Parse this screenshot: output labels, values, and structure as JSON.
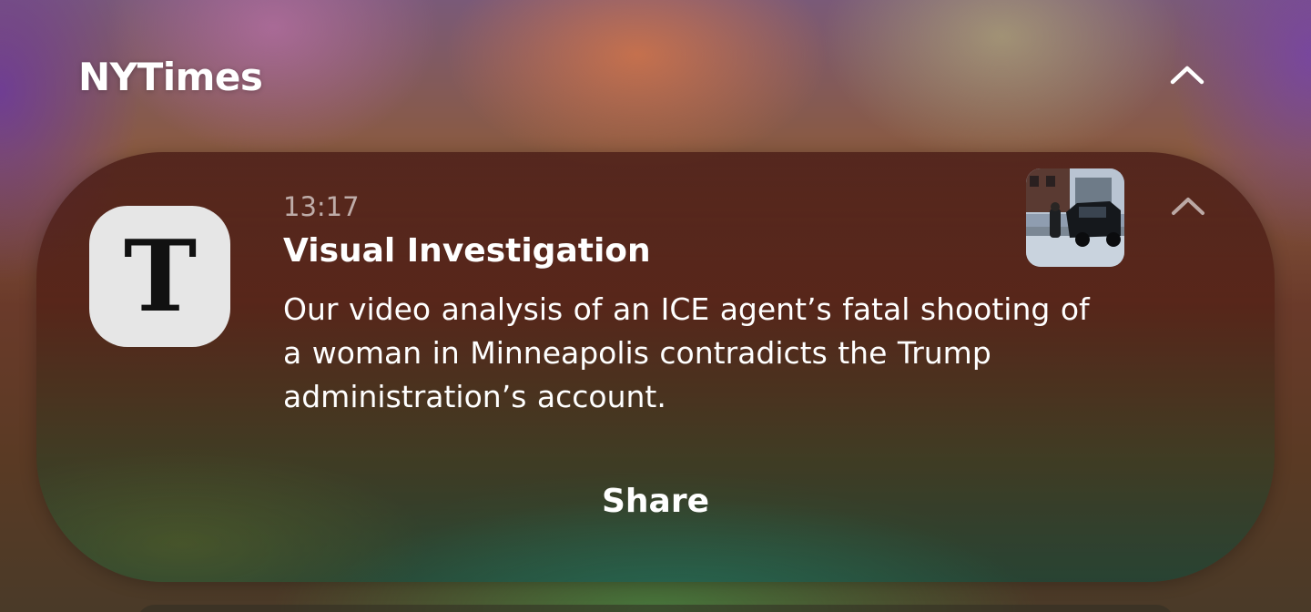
{
  "group": {
    "title": "NYTimes",
    "collapse_icon": "chevron-up-icon"
  },
  "notification": {
    "app_icon": "nyt-logo-icon",
    "app_icon_glyph": "T",
    "time": "13:17",
    "title": "Visual Investigation",
    "body": "Our video analysis of an ICE agent’s fatal shooting of a woman in Minneapolis contradicts the Trump administration’s account.",
    "thumbnail": "news-photo-thumbnail",
    "expand_icon": "chevron-up-icon",
    "action_label": "Share"
  }
}
